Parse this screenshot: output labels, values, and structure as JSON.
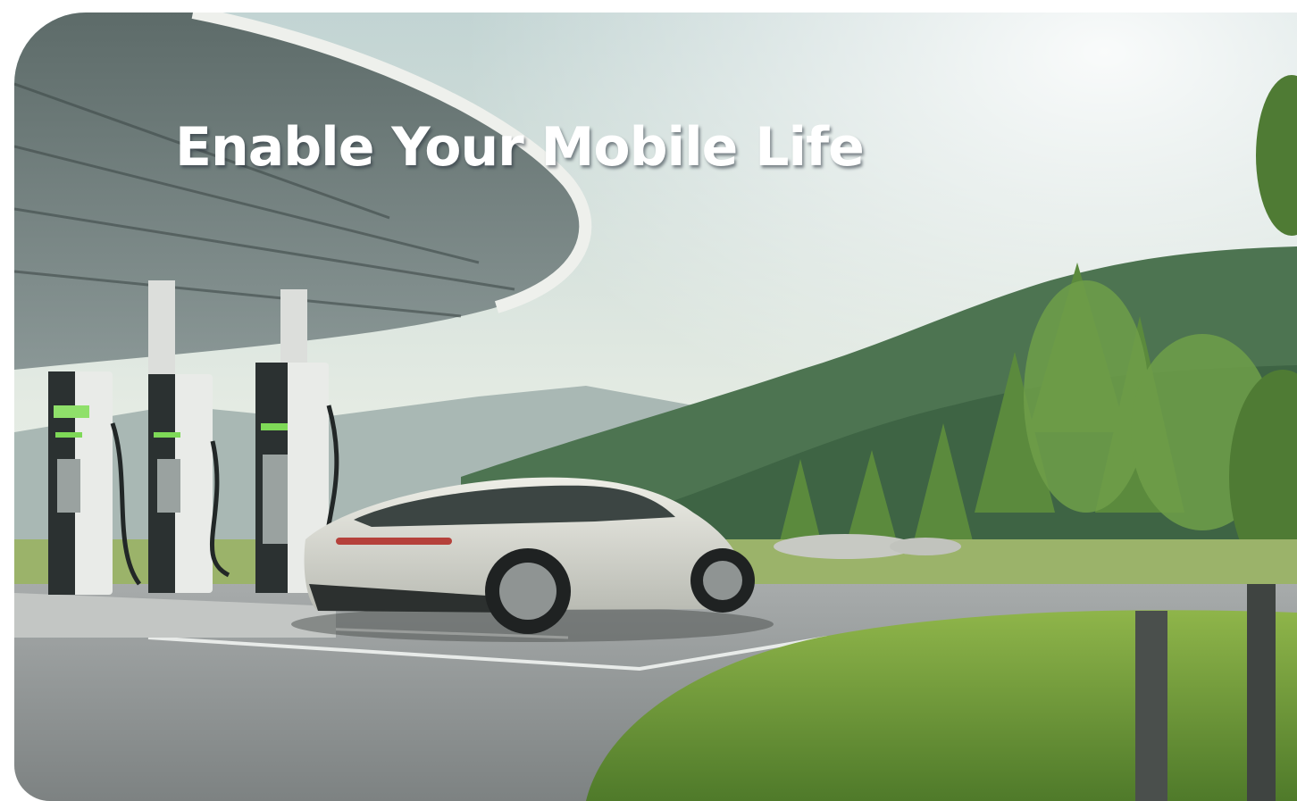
{
  "hero": {
    "headline": "Enable Your Mobile Life"
  },
  "colors": {
    "sky_top": "#c9d8d6",
    "sky_bottom": "#e9eee6",
    "mountain_far": "#9fb0ad",
    "forest": "#3f6a45",
    "grass": "#6f9a3c",
    "pavement": "#9a9e9f",
    "car_body": "#dcdcd4",
    "canopy": "#e4e6e2",
    "charger_screen": "#7ed957"
  }
}
